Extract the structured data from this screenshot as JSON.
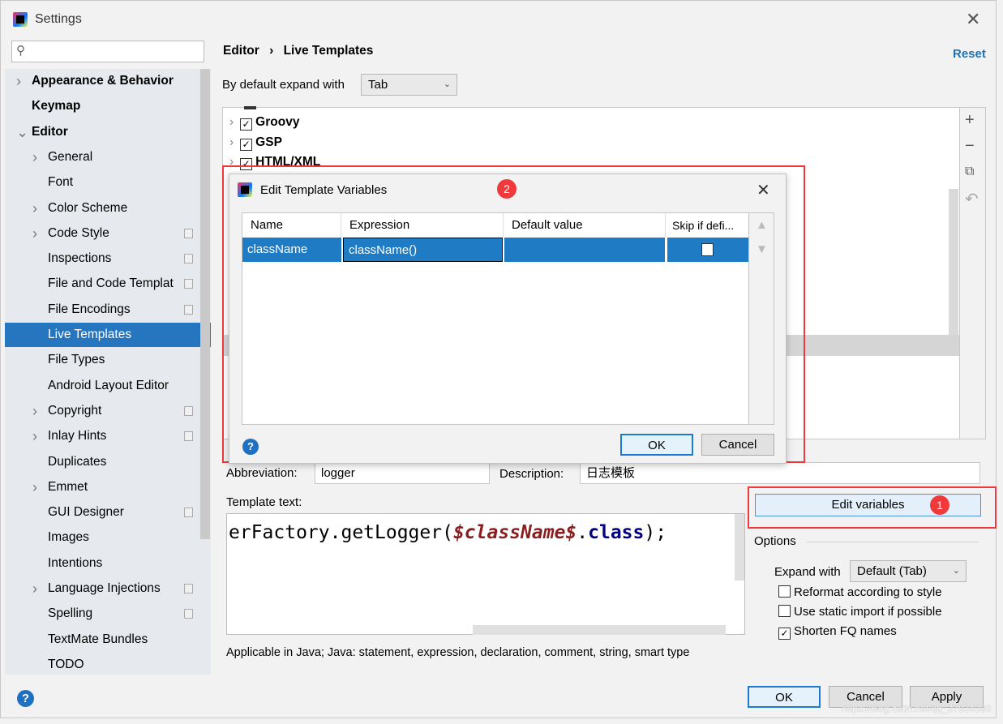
{
  "window": {
    "title": "Settings",
    "close_icon": "close-icon"
  },
  "search": {
    "placeholder": ""
  },
  "sidebar": {
    "items": [
      {
        "label": "Appearance & Behavior",
        "bold": true,
        "chevron": "right",
        "copy": false
      },
      {
        "label": "Keymap",
        "bold": true,
        "chevron": "",
        "copy": false
      },
      {
        "label": "Editor",
        "bold": true,
        "chevron": "down",
        "copy": false
      },
      {
        "label": "General",
        "chevron": "right",
        "copy": false
      },
      {
        "label": "Font",
        "chevron": "",
        "copy": false
      },
      {
        "label": "Color Scheme",
        "chevron": "right",
        "copy": false
      },
      {
        "label": "Code Style",
        "chevron": "right",
        "copy": true
      },
      {
        "label": "Inspections",
        "chevron": "",
        "copy": true
      },
      {
        "label": "File and Code Templat",
        "chevron": "",
        "copy": true
      },
      {
        "label": "File Encodings",
        "chevron": "",
        "copy": true
      },
      {
        "label": "Live Templates",
        "chevron": "",
        "copy": false,
        "selected": true
      },
      {
        "label": "File Types",
        "chevron": "",
        "copy": false
      },
      {
        "label": "Android Layout Editor",
        "chevron": "",
        "copy": false
      },
      {
        "label": "Copyright",
        "chevron": "right",
        "copy": true
      },
      {
        "label": "Inlay Hints",
        "chevron": "right",
        "copy": true
      },
      {
        "label": "Duplicates",
        "chevron": "",
        "copy": false
      },
      {
        "label": "Emmet",
        "chevron": "right",
        "copy": false
      },
      {
        "label": "GUI Designer",
        "chevron": "",
        "copy": true
      },
      {
        "label": "Images",
        "chevron": "",
        "copy": false
      },
      {
        "label": "Intentions",
        "chevron": "",
        "copy": false
      },
      {
        "label": "Language Injections",
        "chevron": "right",
        "copy": true
      },
      {
        "label": "Spelling",
        "chevron": "",
        "copy": true
      },
      {
        "label": "TextMate Bundles",
        "chevron": "",
        "copy": false
      },
      {
        "label": "TODO",
        "chevron": "",
        "copy": false
      }
    ]
  },
  "breadcrumb": {
    "parent": "Editor",
    "separator": "›",
    "current": "Live Templates"
  },
  "reset_label": "Reset",
  "expand_default": {
    "label": "By default expand with",
    "value": "Tab"
  },
  "template_groups": [
    {
      "label": "Groovy",
      "checked": true
    },
    {
      "label": "GSP",
      "checked": true
    },
    {
      "label": "HTML/XML",
      "checked": true
    }
  ],
  "dialog": {
    "title": "Edit Template Variables",
    "badge": "2",
    "columns": [
      "Name",
      "Expression",
      "Default value",
      "Skip if defi..."
    ],
    "rows": [
      {
        "name": "className",
        "expression": "className()",
        "default_value": "",
        "skip_if_defined": false
      }
    ],
    "ok_label": "OK",
    "cancel_label": "Cancel"
  },
  "abbreviation": {
    "label": "Abbreviation:",
    "value": "logger"
  },
  "description": {
    "label": "Description:",
    "value": "日志模板"
  },
  "template_text": {
    "label": "Template text:",
    "prefix": "erFactory.getLogger(",
    "variable": "$className$",
    "dot": ".",
    "keyword": "class",
    "suffix": ");"
  },
  "edit_variables": {
    "label": "Edit variables",
    "badge": "1"
  },
  "options": {
    "title": "Options",
    "expand_with_label": "Expand with",
    "expand_with_value": "Default (Tab)",
    "checkboxes": [
      {
        "label": "Reformat according to style",
        "checked": false
      },
      {
        "label": "Use static import if possible",
        "checked": false
      },
      {
        "label": "Shorten FQ names",
        "checked": true
      }
    ]
  },
  "applicable": "Applicable in Java; Java: statement, expression, declaration, comment, string, smart type",
  "footer": {
    "ok": "OK",
    "cancel": "Cancel",
    "apply": "Apply"
  },
  "watermark": "https://blog.csdn.net/qq_37834380",
  "colors": {
    "selection": "#2675bf",
    "accent_link": "#2470b3",
    "annotation": "#f0393b"
  }
}
